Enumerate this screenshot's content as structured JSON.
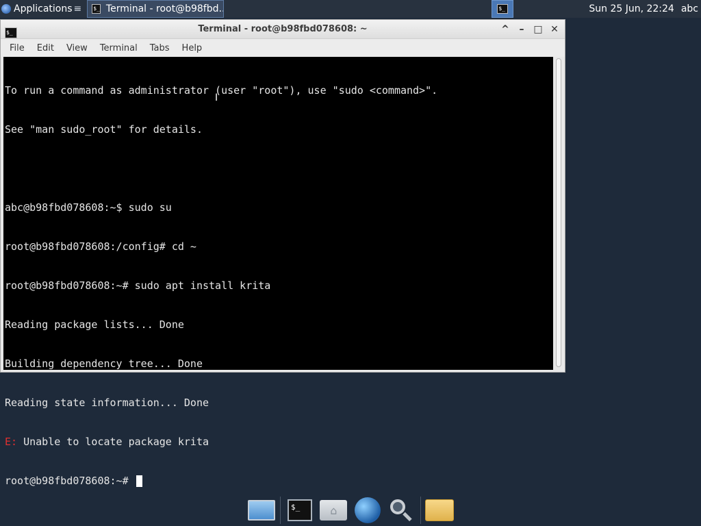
{
  "panel": {
    "apps_label": "Applications",
    "apps_sep": "≡",
    "task_title": "Terminal - root@b98fbd...",
    "clock": "Sun 25 Jun, 22:24",
    "user": "abc"
  },
  "window": {
    "title": "Terminal - root@b98fbd078608: ~",
    "controls": [
      "^",
      "–",
      "□",
      "✕"
    ]
  },
  "menu": [
    "File",
    "Edit",
    "View",
    "Terminal",
    "Tabs",
    "Help"
  ],
  "terminal": {
    "lines": [
      "To run a command as administrator (user \"root\"), use \"sudo <command>\".",
      "See \"man sudo_root\" for details.",
      "",
      "abc@b98fbd078608:~$ sudo su",
      "root@b98fbd078608:/config# cd ~",
      "root@b98fbd078608:~# sudo apt install krita",
      "Reading package lists... Done",
      "Building dependency tree... Done",
      "Reading state information... Done"
    ],
    "error_prefix": "E:",
    "error_text": " Unable to locate package krita",
    "prompt": "root@b98fbd078608:~# "
  },
  "dock": {
    "items": [
      "desktop-icon",
      "terminal-icon",
      "home-folder-icon",
      "web-browser-icon",
      "search-icon",
      "files-icon"
    ],
    "terminal_glyph": "$_"
  },
  "colors": {
    "panel_bg": "#28323f",
    "desktop_bg": "#1e2a3a",
    "terminal_bg": "#000000",
    "terminal_fg": "#e6e6e6",
    "error_red": "#e03030"
  }
}
